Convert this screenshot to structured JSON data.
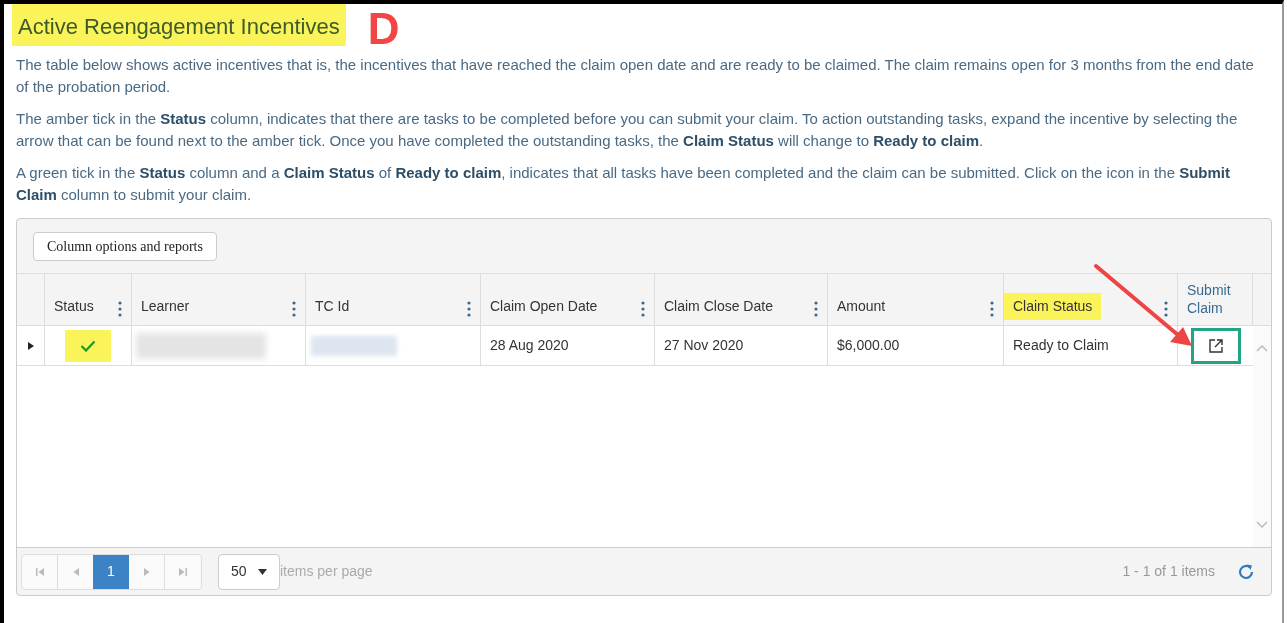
{
  "title": "Active Reengagement Incentives",
  "annotation_letter": "D",
  "paragraphs": [
    "The table below shows active incentives that is, the incentives that have reached the claim open date and are ready to be claimed. The claim remains open for 3 months from the end date of the probation period.",
    "The amber tick in the **Status** column, indicates that there are tasks to be completed before you can submit your claim. To action outstanding tasks, expand the incentive by selecting the arrow that can be found next to the amber tick. Once you have completed the outstanding tasks, the **Claim Status** will change to **Ready to claim**.",
    "A green tick in the **Status** column and a **Claim Status** of **Ready to claim**, indicates that all tasks have been completed and the claim can be submitted. Click on the icon in the **Submit Claim** column to submit your claim."
  ],
  "toolbar": {
    "button": "Column options and reports"
  },
  "table": {
    "columns": [
      {
        "label": "Status",
        "has_menu": true,
        "highlighted": false
      },
      {
        "label": "Learner",
        "has_menu": true,
        "highlighted": false
      },
      {
        "label": "TC Id",
        "has_menu": true,
        "highlighted": false
      },
      {
        "label": "Claim Open Date",
        "has_menu": true,
        "highlighted": false
      },
      {
        "label": "Claim Close Date",
        "has_menu": true,
        "highlighted": false
      },
      {
        "label": "Amount",
        "has_menu": true,
        "highlighted": false
      },
      {
        "label": "Claim Status",
        "has_menu": true,
        "highlighted": true
      },
      {
        "label": "Submit Claim",
        "has_menu": false,
        "highlighted": false
      }
    ],
    "rows": [
      {
        "expanded": false,
        "status_complete": true,
        "status_highlighted": true,
        "claim_open_date": "28 Aug 2020",
        "claim_close_date": "27 Nov 2020",
        "amount": "$6,000.00",
        "claim_status": "Ready to Claim",
        "submit_highlighted": true
      }
    ]
  },
  "pager": {
    "pages": [
      {
        "label": "1",
        "selected": true
      }
    ],
    "page_size": "50",
    "page_size_label": "items per page",
    "summary": "1 - 1 of 1 items"
  }
}
